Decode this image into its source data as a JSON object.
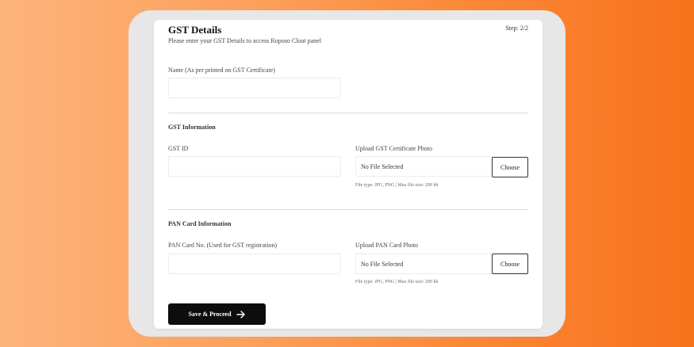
{
  "header": {
    "title": "GST Details",
    "subtitle": "Please enter your GST Details to access Roposo Clout panel",
    "step": "Step: 2/2"
  },
  "name_field": {
    "label": "Name (As per printed on GST Certificate)",
    "value": ""
  },
  "gst_section": {
    "heading": "GST Information",
    "gst_id_label": "GST ID",
    "gst_id_value": "",
    "upload_label": "Upload GST Certificate Photo",
    "file_status": "No File Selected",
    "choose_label": "Choose",
    "hint": "File type: JPG, PNG | Max file size: 200 kb"
  },
  "pan_section": {
    "heading": "PAN Card Information",
    "pan_label": "PAN Card No. (Used for GST registration)",
    "pan_value": "",
    "upload_label": "Upload PAN Card Photo",
    "file_status": "No File Selected",
    "choose_label": "Choose",
    "hint": "File type: JPG, PNG | Max file size: 200 kb"
  },
  "footer": {
    "save_label": "Save & Proceed",
    "save_icon": "arrow-right-icon"
  },
  "colors": {
    "background_start": "#fdb37a",
    "background_end": "#f8711c",
    "button": "#0d0d0d"
  }
}
